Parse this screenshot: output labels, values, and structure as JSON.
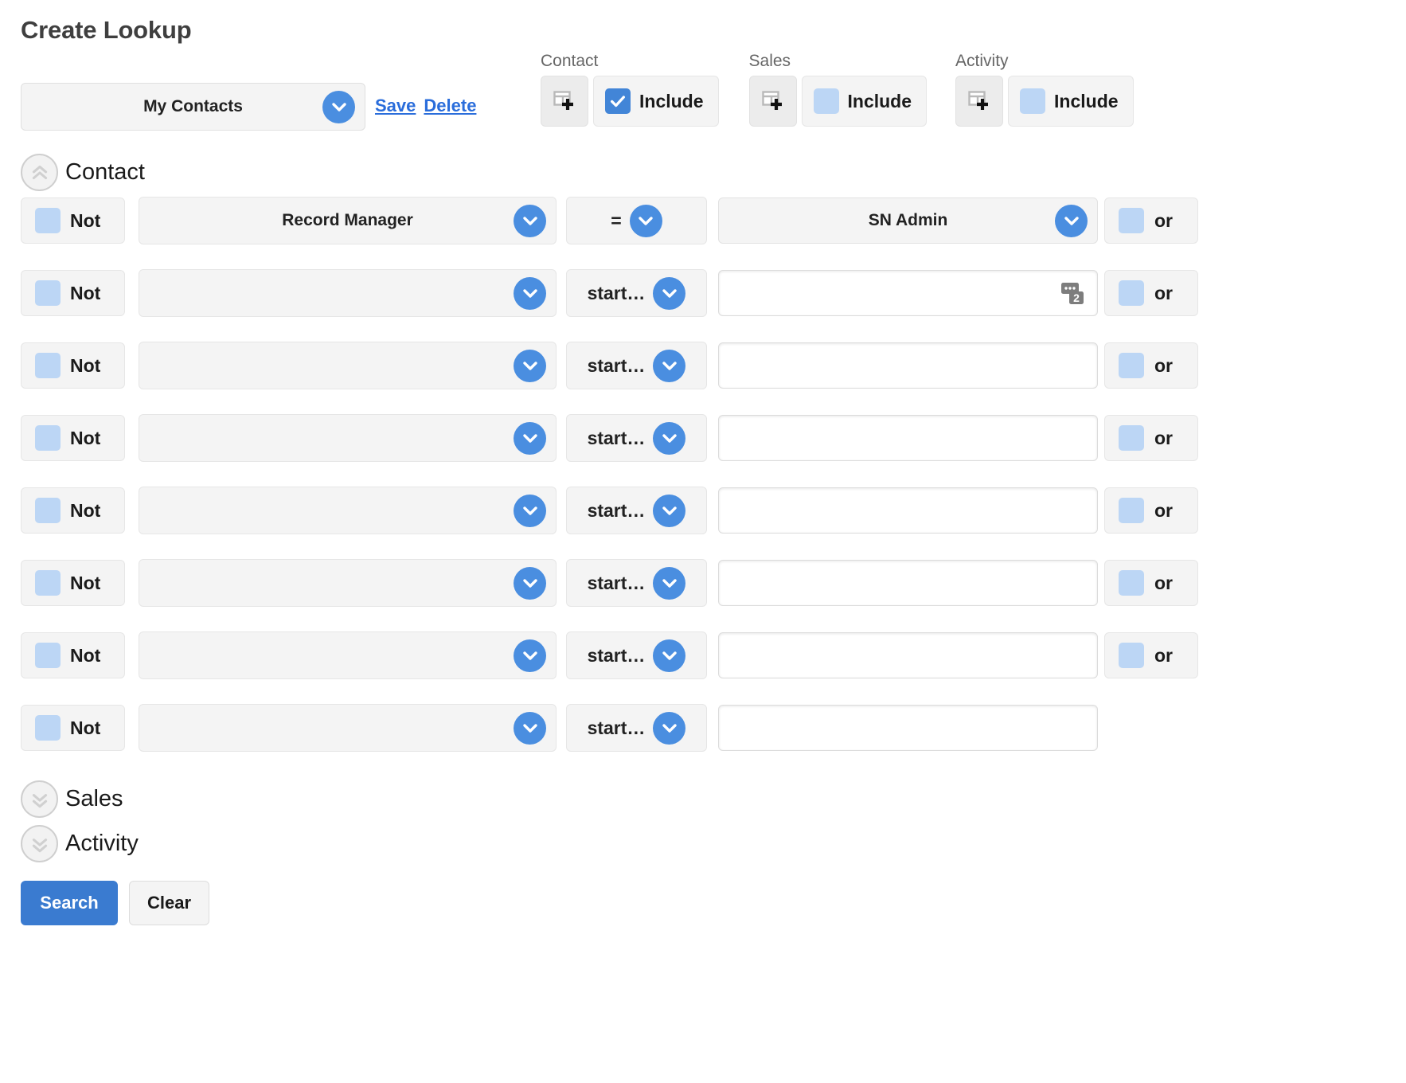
{
  "page_title": "Create Lookup",
  "saved_lookup": {
    "selected": "My Contacts",
    "dropdown_icon": "chevron-down-icon",
    "save_label": "Save",
    "delete_label": "Delete"
  },
  "entity_groups": [
    {
      "caption": "Contact",
      "add_icon": "add-column-icon",
      "include_label": "Include",
      "included": true
    },
    {
      "caption": "Sales",
      "add_icon": "add-column-icon",
      "include_label": "Include",
      "included": false
    },
    {
      "caption": "Activity",
      "add_icon": "add-column-icon",
      "include_label": "Include",
      "included": false
    }
  ],
  "sections": [
    {
      "label": "Contact",
      "expanded": true,
      "toggle_icon": "double-chevron-up-icon"
    },
    {
      "label": "Sales",
      "expanded": false,
      "toggle_icon": "double-chevron-down-icon"
    },
    {
      "label": "Activity",
      "expanded": false,
      "toggle_icon": "double-chevron-down-icon"
    }
  ],
  "filter_labels": {
    "not": "Not",
    "or": "or"
  },
  "filter_rows": [
    {
      "not_checked": false,
      "field": "Record Manager",
      "operator": "=",
      "value": "SN Admin",
      "value_type": "select",
      "has_or": true,
      "or_checked": false,
      "badge": null
    },
    {
      "not_checked": false,
      "field": "",
      "operator": "start…",
      "value": "",
      "value_type": "text",
      "has_or": true,
      "or_checked": false,
      "badge": "2"
    },
    {
      "not_checked": false,
      "field": "",
      "operator": "start…",
      "value": "",
      "value_type": "text",
      "has_or": true,
      "or_checked": false,
      "badge": null
    },
    {
      "not_checked": false,
      "field": "",
      "operator": "start…",
      "value": "",
      "value_type": "text",
      "has_or": true,
      "or_checked": false,
      "badge": null
    },
    {
      "not_checked": false,
      "field": "",
      "operator": "start…",
      "value": "",
      "value_type": "text",
      "has_or": true,
      "or_checked": false,
      "badge": null
    },
    {
      "not_checked": false,
      "field": "",
      "operator": "start…",
      "value": "",
      "value_type": "text",
      "has_or": true,
      "or_checked": false,
      "badge": null
    },
    {
      "not_checked": false,
      "field": "",
      "operator": "start…",
      "value": "",
      "value_type": "text",
      "has_or": true,
      "or_checked": false,
      "badge": null
    },
    {
      "not_checked": false,
      "field": "",
      "operator": "start…",
      "value": "",
      "value_type": "text",
      "has_or": false,
      "or_checked": false,
      "badge": null
    }
  ],
  "actions": {
    "search_label": "Search",
    "clear_label": "Clear"
  },
  "colors": {
    "accent_blue": "#4a8ee0",
    "checkbox_on": "#4285d7",
    "checkbox_off": "#bcd6f5",
    "link_blue": "#2a6ddb",
    "primary_button": "#3a7bd0",
    "control_bg": "#f4f4f4"
  }
}
